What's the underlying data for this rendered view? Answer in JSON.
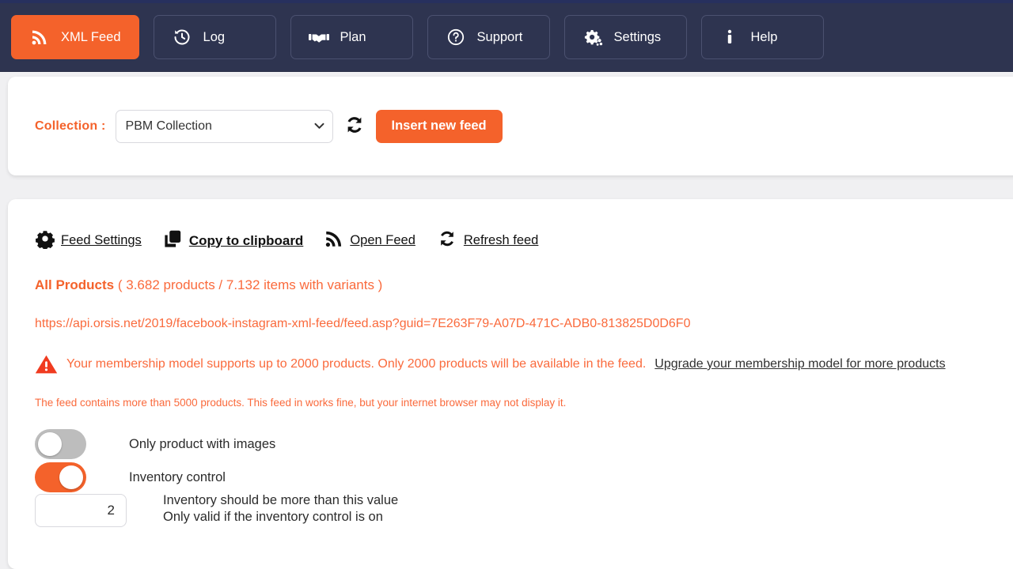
{
  "theme": {
    "accent": "#f4622b",
    "accent_text": "#fa6a3c",
    "navbar_bg": "#2e3450",
    "top_strip": "#27305e",
    "page_bg": "#f0f0f2",
    "switch_off": "#bdbdbd"
  },
  "navbar": {
    "items": [
      {
        "label": "XML Feed",
        "icon": "rss-icon",
        "active": true
      },
      {
        "label": "Log",
        "icon": "history-clock-icon",
        "active": false
      },
      {
        "label": "Plan",
        "icon": "handshake-icon",
        "active": false
      },
      {
        "label": "Support",
        "icon": "question-circle-icon",
        "active": false
      },
      {
        "label": "Settings",
        "icon": "gears-icon",
        "active": false
      },
      {
        "label": "Help",
        "icon": "info-icon",
        "active": false
      }
    ]
  },
  "collection_bar": {
    "label": "Collection :",
    "select": {
      "value": "PBM Collection",
      "options": [
        "PBM Collection"
      ]
    },
    "refresh_icon": "refresh-sync-icon",
    "insert_button": "Insert new feed"
  },
  "feed_panel": {
    "toolbar": [
      {
        "label": "Feed Settings",
        "icon": "gear-icon",
        "strong": false
      },
      {
        "label": "Copy to clipboard",
        "icon": "clipboard-copy-icon",
        "strong": true
      },
      {
        "label": "Open Feed",
        "icon": "rss-icon",
        "strong": false
      },
      {
        "label": "Refresh feed",
        "icon": "refresh-sync-icon",
        "strong": false
      }
    ],
    "all_products_title": "All Products",
    "all_products_counts": "( 3.682 products / 7.132 items with variants )",
    "feed_url": "https://api.orsis.net/2019/facebook-instagram-xml-feed/feed.asp?guid=7E263F79-A07D-471C-ADB0-813825D0D6F0",
    "warning": {
      "icon": "warning-triangle-icon",
      "text": "Your membership model supports up to 2000 products. Only 2000 products will be available in the feed.",
      "link": "Upgrade your membership model for more products"
    },
    "note": "The feed contains more than 5000 products. This feed in works fine, but your internet browser may not display it.",
    "options": [
      {
        "name": "only-products-with-images",
        "label": "Only product with images",
        "state": "off"
      },
      {
        "name": "inventory-control",
        "label": "Inventory control",
        "state": "on"
      }
    ],
    "inventory_value": {
      "value": "2",
      "label_line1": "Inventory should be more than this value",
      "label_line2": "Only valid if the inventory control is on"
    }
  }
}
